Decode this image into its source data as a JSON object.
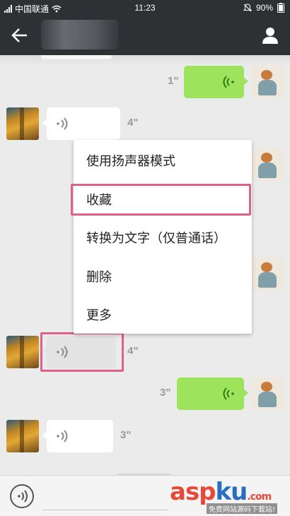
{
  "status_bar": {
    "carrier": "中国联通",
    "time": "11:23",
    "battery": "90%",
    "icons": [
      "signal-icon",
      "wifi-icon",
      "mute-icon",
      "battery-icon"
    ]
  },
  "header": {
    "back_icon": "back-arrow-icon",
    "profile_icon": "person-icon"
  },
  "messages": [
    {
      "side": "right",
      "type": "voice",
      "duration": "1\""
    },
    {
      "side": "left",
      "type": "voice",
      "duration": "4\""
    },
    {
      "side": "right",
      "type": "voice",
      "duration": ""
    },
    {
      "side": "right",
      "type": "voice",
      "duration": ""
    },
    {
      "side": "left",
      "type": "voice",
      "duration": "4\"",
      "selected": true
    },
    {
      "side": "right",
      "type": "voice",
      "duration": "3\""
    },
    {
      "side": "left",
      "type": "voice",
      "duration": "3\""
    }
  ],
  "context_menu": {
    "items": [
      {
        "label": "使用扬声器模式"
      },
      {
        "label": "收藏",
        "highlighted": true
      },
      {
        "label": "转换为文字（仅普通话）"
      },
      {
        "label": "删除"
      },
      {
        "label": "更多"
      }
    ]
  },
  "colors": {
    "header_bg": "#2e3134",
    "chat_bg": "#ebebeb",
    "outgoing_bubble": "#9de45c",
    "incoming_bubble": "#ffffff",
    "highlight_box": "#e05f8b",
    "wave_outgoing": "#2f7d12",
    "wave_incoming": "#8a8a8a"
  },
  "watermark": {
    "brand_red": "asp",
    "brand_blue": "ku",
    "brand_tail": ".com",
    "tagline": "免费网站源码下载站!"
  }
}
